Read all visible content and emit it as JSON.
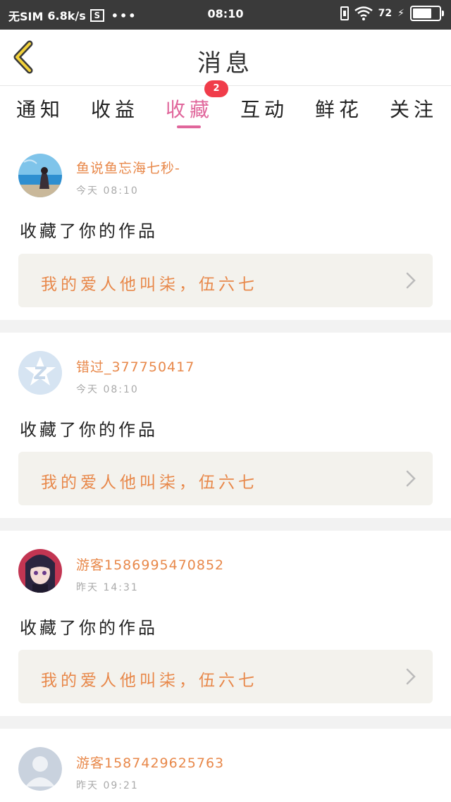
{
  "status_bar": {
    "carrier": "无SIM",
    "speed": "6.8k/s",
    "s_icon": "S",
    "dots": "•••",
    "time": "08:10",
    "battery": "72"
  },
  "header": {
    "title": "消息"
  },
  "tabs": [
    {
      "label": "通知",
      "active": false
    },
    {
      "label": "收益",
      "active": false
    },
    {
      "label": "收藏",
      "active": true,
      "badge": "2"
    },
    {
      "label": "互动",
      "active": false
    },
    {
      "label": "鲜花",
      "active": false
    },
    {
      "label": "关注",
      "active": false
    }
  ],
  "colors": {
    "accent_pink": "#e0669b",
    "name_orange": "#e8884a",
    "badge_red": "#f03c4a"
  },
  "messages": [
    {
      "username": "鱼说鱼忘海七秒-",
      "time": "今天  08:10",
      "action": "收藏了你的作品",
      "work_title": "我的爱人他叫柒，伍六七",
      "avatar": "photo-avatar"
    },
    {
      "username": "错过_377750417",
      "time": "今天  08:10",
      "action": "收藏了你的作品",
      "work_title": "我的爱人他叫柒，伍六七",
      "avatar": "qq-default-avatar"
    },
    {
      "username": "游客1586995470852",
      "time": "昨天  14:31",
      "action": "收藏了你的作品",
      "work_title": "我的爱人他叫柒，伍六七",
      "avatar": "anime-avatar"
    },
    {
      "username": "游客1587429625763",
      "time": "昨天  09:21",
      "action": "",
      "work_title": "",
      "avatar": "default-user-avatar"
    }
  ]
}
